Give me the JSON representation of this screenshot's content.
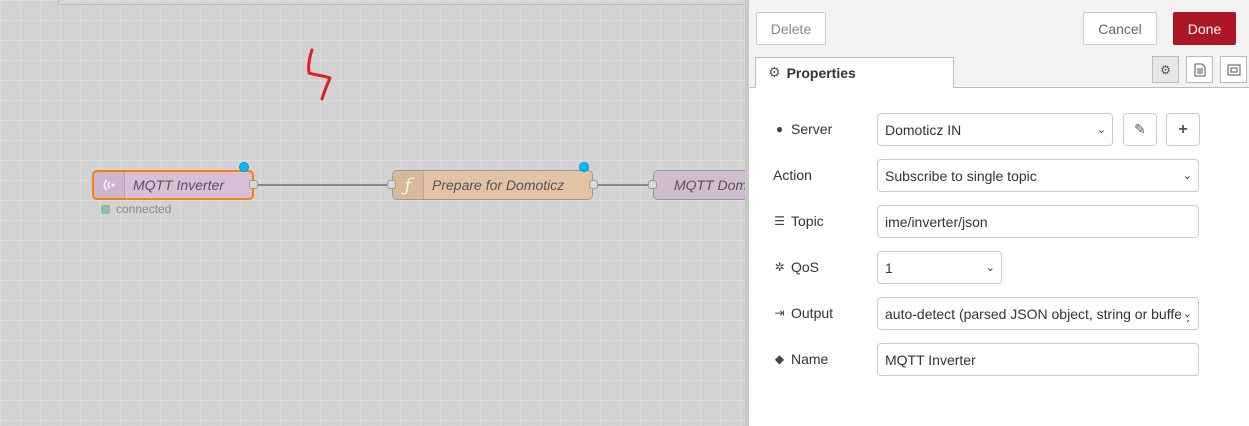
{
  "flow": {
    "nodes": [
      {
        "label": "MQTT Inverter",
        "icon": "radio-waves-icon",
        "status": "connected"
      },
      {
        "label": "Prepare for Domoticz",
        "icon": "function-icon"
      },
      {
        "label": "MQTT Dom",
        "icon": "none"
      }
    ],
    "annotation": "red-hand-drawn-mark"
  },
  "editor": {
    "toolbar": {
      "delete_label": "Delete",
      "cancel_label": "Cancel",
      "done_label": "Done"
    },
    "tab": {
      "label": "Properties",
      "icon": "gear-icon"
    },
    "tab_icons": [
      "gear-icon",
      "description-icon",
      "appearance-icon"
    ],
    "fields": {
      "server": {
        "label": "Server",
        "icon": "globe-icon",
        "value": "Domoticz IN"
      },
      "action": {
        "label": "Action",
        "value": "Subscribe to single topic"
      },
      "topic": {
        "label": "Topic",
        "icon": "tasks-icon",
        "value": "ime/inverter/json"
      },
      "qos": {
        "label": "QoS",
        "icon": "empire-icon",
        "value": "1"
      },
      "output": {
        "label": "Output",
        "icon": "sign-out-icon",
        "value": "auto-detect (parsed JSON object, string or buffer)"
      },
      "name": {
        "label": "Name",
        "icon": "tag-icon",
        "value": "MQTT Inverter"
      }
    }
  },
  "colors": {
    "done": "#ad1625",
    "mqtt_node": "#d8bfd8",
    "function_node": "#fdd0a2",
    "selected_border": "#ff7f0e",
    "changed_dot": "#00bcff",
    "annotation": "#e02020"
  }
}
